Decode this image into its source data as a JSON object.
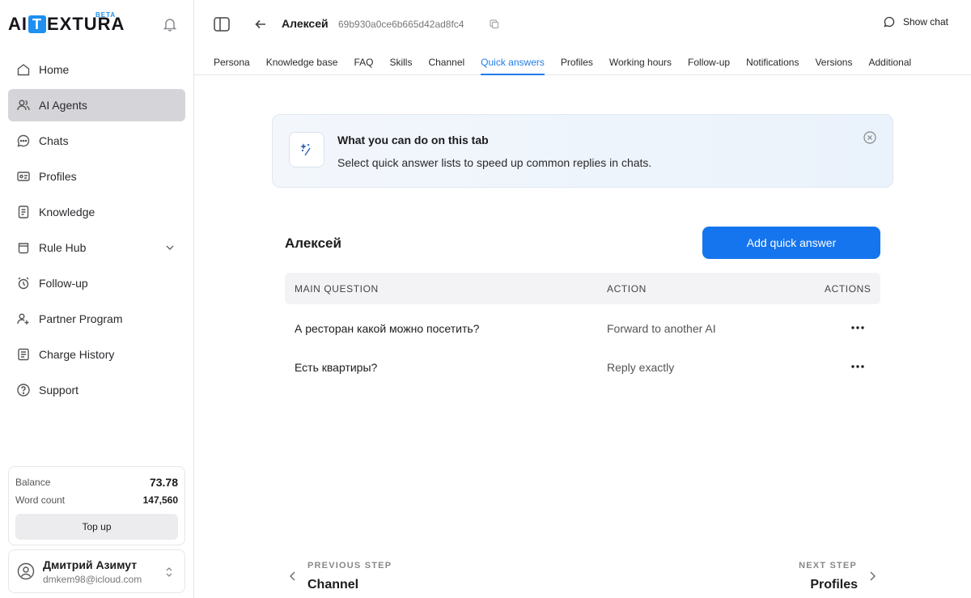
{
  "brand": {
    "logo_left": "AI",
    "logo_t": "T",
    "logo_right": "EXTURA",
    "beta": "BETA"
  },
  "sidebar": {
    "items": [
      {
        "label": "Home",
        "icon": "home-icon"
      },
      {
        "label": "AI Agents",
        "icon": "users-icon",
        "active": true
      },
      {
        "label": "Chats",
        "icon": "chat-bubble-icon"
      },
      {
        "label": "Profiles",
        "icon": "id-card-icon"
      },
      {
        "label": "Knowledge",
        "icon": "document-icon"
      },
      {
        "label": "Rule Hub",
        "icon": "cup-icon"
      },
      {
        "label": "Follow-up",
        "icon": "alarm-clock-icon"
      },
      {
        "label": "Partner Program",
        "icon": "partner-icon"
      },
      {
        "label": "Charge History",
        "icon": "receipt-icon"
      },
      {
        "label": "Support",
        "icon": "help-circle-icon"
      }
    ],
    "balance_label": "Balance",
    "balance_value": "73.78",
    "word_count_label": "Word count",
    "word_count_value": "147,560",
    "top_up": "Top up",
    "user_name": "Дмитрий Азимут",
    "user_email": "dmkem98@icloud.com"
  },
  "header": {
    "agent_name": "Алексей",
    "agent_id": "69b930a0ce6b665d42ad8fc4",
    "show_chat": "Show chat"
  },
  "tabs": [
    "Persona",
    "Knowledge base",
    "FAQ",
    "Skills",
    "Channel",
    "Quick answers",
    "Profiles",
    "Working hours",
    "Follow-up",
    "Notifications",
    "Versions",
    "Additional"
  ],
  "active_tab": "Quick answers",
  "banner": {
    "title": "What you can do on this tab",
    "text": "Select quick answer lists to speed up common replies in chats."
  },
  "section": {
    "title": "Алексей",
    "add_button": "Add quick answer"
  },
  "table": {
    "headers": {
      "question": "MAIN QUESTION",
      "action": "ACTION",
      "actions": "ACTIONS"
    },
    "rows": [
      {
        "question": "А ресторан какой можно посетить?",
        "action": "Forward to another AI"
      },
      {
        "question": "Есть квартиры?",
        "action": "Reply exactly"
      }
    ]
  },
  "steps": {
    "prev_label": "PREVIOUS STEP",
    "prev_value": "Channel",
    "next_label": "NEXT STEP",
    "next_value": "Profiles"
  },
  "colors": {
    "accent": "#1575ee",
    "active_nav": "#d5d5d9",
    "tab_active": "#1f7de8"
  }
}
